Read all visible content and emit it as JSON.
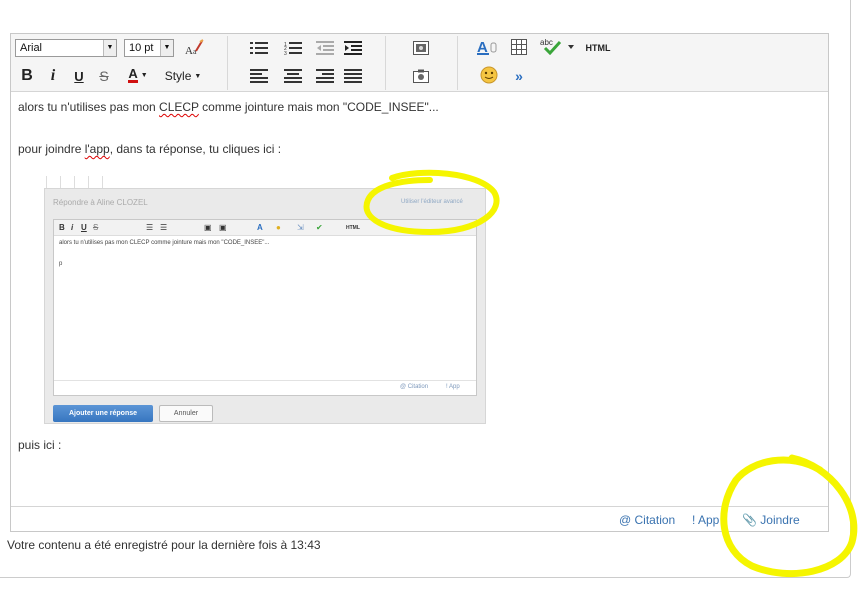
{
  "toolbar": {
    "font_family": "Arial",
    "font_size": "10 pt",
    "bold_label": "B",
    "italic_label": "i",
    "underline_label": "U",
    "strike_label": "S",
    "font_color_label": "A",
    "style_label": "Style",
    "html_label": "HTML",
    "more_label": "»",
    "font_color_accent": "#d01010",
    "link_color": "#2a6ec0"
  },
  "content": {
    "line1_a": "alors tu n'utilises pas mon ",
    "line1_clecp": "CLECP",
    "line1_b": " comme jointure mais mon \"CODE_INSEE\"...",
    "line2_a": "pour joindre ",
    "line2_app": "l'app",
    "line2_b": ", dans ta réponse, tu cliques ici :",
    "line3": "puis ici :"
  },
  "embedded": {
    "title": "Répondre à Aline CLOZEL",
    "advanced_link": "Utiliser l'éditeur avancé",
    "text_line1": "alors tu n'utilises pas mon CLECP comme jointure mais mon \"CODE_INSEE\"...",
    "text_line2": "p",
    "html_label": "HTML",
    "citation": "@ Citation",
    "app": "! App",
    "submit": "Ajouter une réponse",
    "cancel": "Annuler"
  },
  "footer": {
    "citation": "@ Citation",
    "app": "! App",
    "joindre": "Joindre"
  },
  "status": "Votre contenu a été enregistré pour la dernière fois à 13:43",
  "highlight_color": "#f5f500"
}
